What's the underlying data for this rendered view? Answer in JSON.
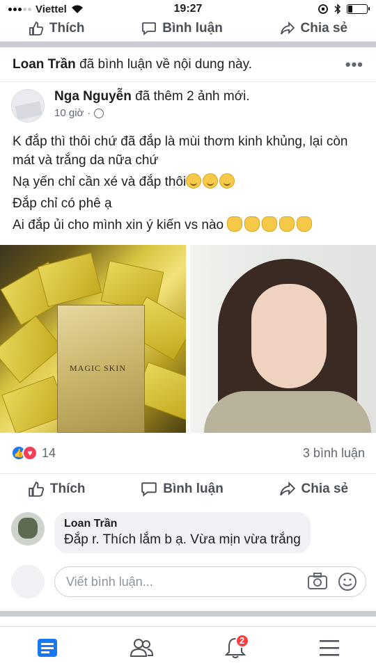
{
  "status_bar": {
    "carrier": "Viettel",
    "time": "19:27"
  },
  "top_actions": {
    "like": "Thích",
    "comment": "Bình luận",
    "share": "Chia sẻ"
  },
  "activity": {
    "name": "Loan Trần",
    "text": " đã bình luận về nội dung này.",
    "more": "•••"
  },
  "post": {
    "author": "Nga Nguyễn",
    "action": " đã thêm 2 ảnh mới.",
    "time": "10 giờ",
    "time_sep": "·",
    "lines": [
      "K đắp thì thôi chứ đã đắp là mùi thơm kinh khủng, lại còn mát và trắng da nữa chứ",
      "Nạ yến chỉ cần xé và đắp thôi",
      "Đắp chỉ có phê ạ",
      "Ai đắp ủi cho mình xin ý kiến vs nào"
    ],
    "photo_left_label": "MAGIC SKIN",
    "reactions_count": "14",
    "comments_count": "3 bình luận"
  },
  "actions": {
    "like": "Thích",
    "comment": "Bình luận",
    "share": "Chia sẻ"
  },
  "comment": {
    "name": "Loan Trần",
    "text": "Đắp r. Thích lắm b ạ. Vừa mịn vừa trắng"
  },
  "writer": {
    "placeholder": "Viết bình luận..."
  },
  "bottom_nav": {
    "notifications_badge": "2"
  },
  "icons": [
    "wifi-icon",
    "battery-icon",
    "like-icon",
    "comment-icon",
    "share-icon",
    "globe-icon",
    "camera-icon",
    "sticker-icon",
    "news-feed-icon",
    "friends-icon",
    "notifications-icon",
    "menu-icon"
  ],
  "colors": {
    "facebook_blue": "#1877f2",
    "love_red": "#f33e58",
    "badge_red": "#fa3e3e",
    "text_gray": "#606770"
  }
}
